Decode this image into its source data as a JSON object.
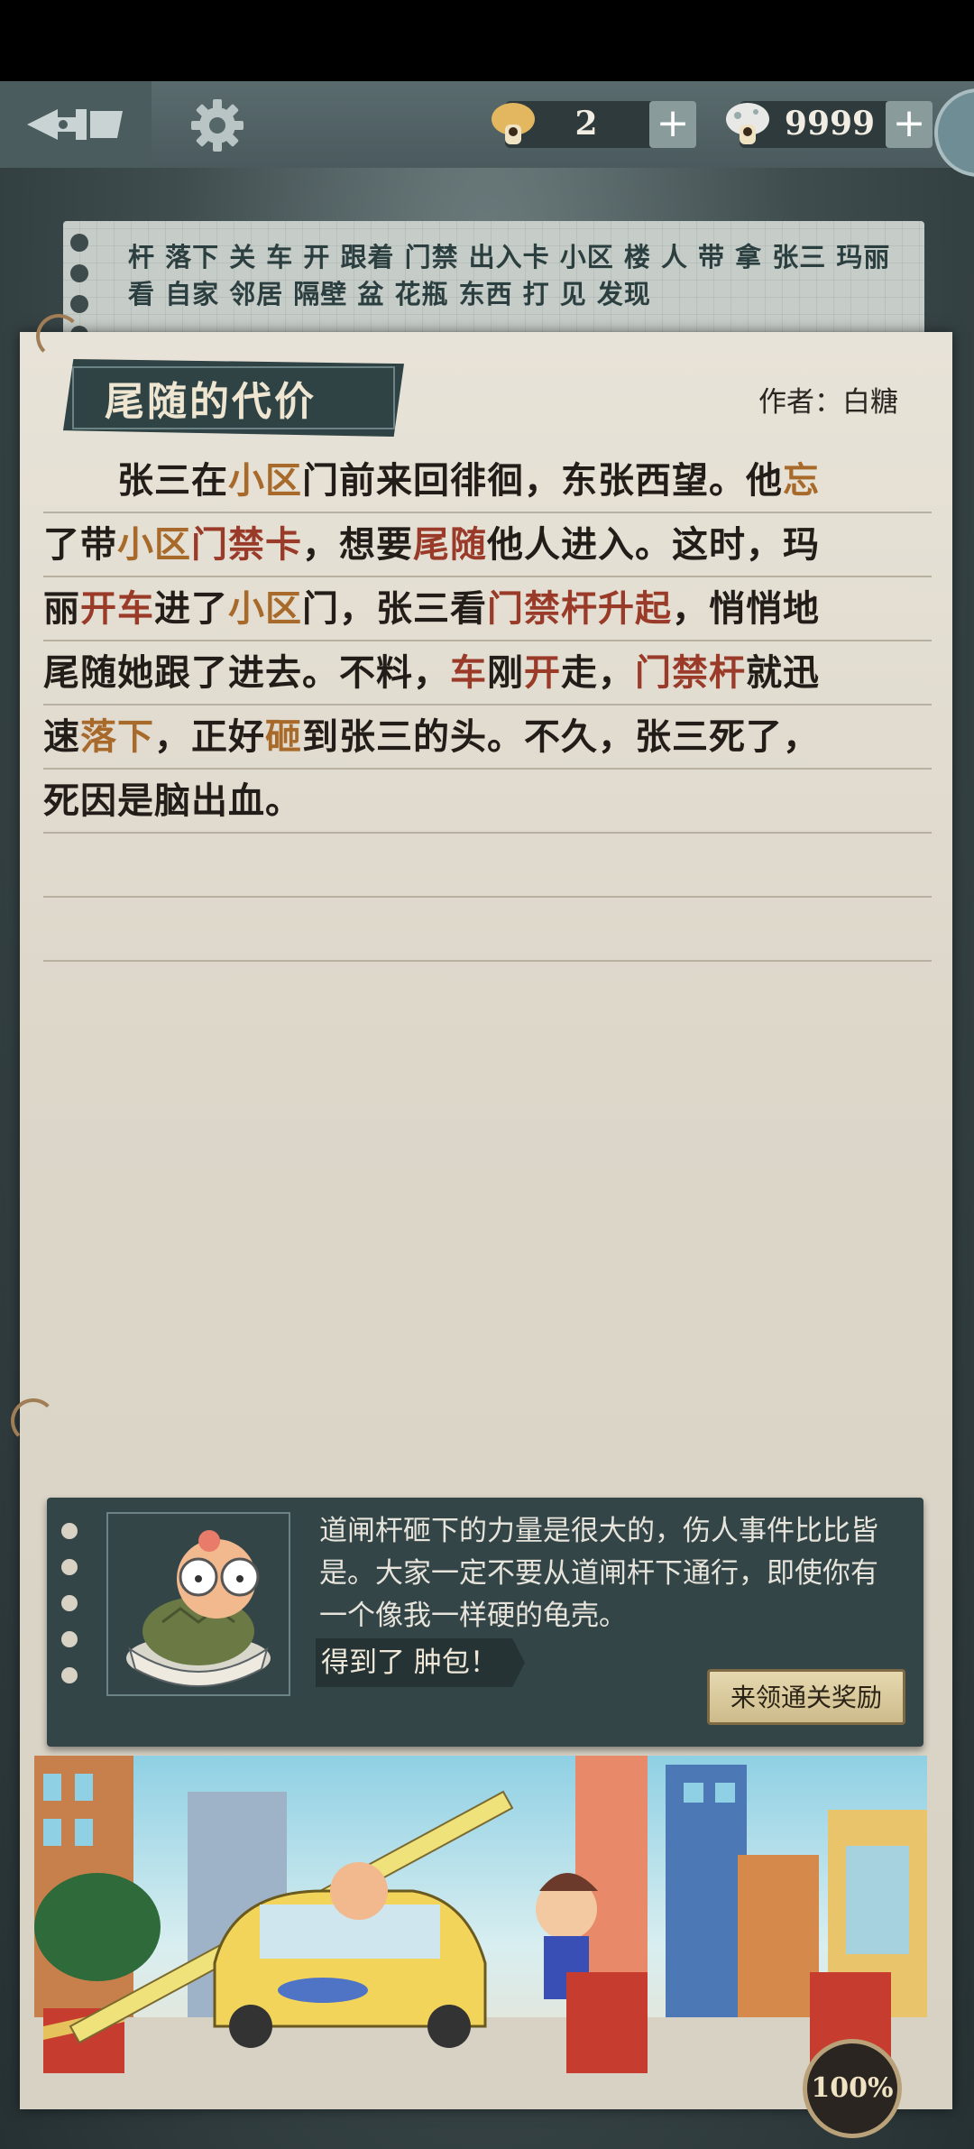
{
  "topbar": {
    "currency1": {
      "icon": "mushroom-icon",
      "value": "2"
    },
    "currency2": {
      "icon": "mushroom-spotted-icon",
      "value": "9999"
    }
  },
  "keywords": {
    "line1": "杆 落下 关 车 开 跟着 门禁 出入卡 小区 楼 人 带 拿 张三 玛丽",
    "line2": "看 自家 邻居 隔壁 盆 花瓶 东西 打 见 发现"
  },
  "story": {
    "title": "尾随的代价",
    "author": "作者：白糖",
    "lines": [
      [
        {
          "t": "　　张三在"
        },
        {
          "t": "小区",
          "c": "o"
        },
        {
          "t": "门前来回徘徊，东张西望。他"
        },
        {
          "t": "忘",
          "c": "o"
        }
      ],
      [
        {
          "t": "了带"
        },
        {
          "t": "小区",
          "c": "o"
        },
        {
          "t": "门禁卡",
          "c": "r"
        },
        {
          "t": "，想要"
        },
        {
          "t": "尾随",
          "c": "r"
        },
        {
          "t": "他人进入。这时，玛"
        }
      ],
      [
        {
          "t": "丽"
        },
        {
          "t": "开车",
          "c": "r"
        },
        {
          "t": "进了"
        },
        {
          "t": "小区",
          "c": "o"
        },
        {
          "t": "门，张三看"
        },
        {
          "t": "门禁杆升起",
          "c": "r"
        },
        {
          "t": "，悄悄地"
        }
      ],
      [
        {
          "t": "尾随她跟了进去。不料，"
        },
        {
          "t": "车",
          "c": "r"
        },
        {
          "t": "刚"
        },
        {
          "t": "开",
          "c": "r"
        },
        {
          "t": "走，"
        },
        {
          "t": "门禁杆",
          "c": "r"
        },
        {
          "t": "就迅"
        }
      ],
      [
        {
          "t": "速"
        },
        {
          "t": "落下",
          "c": "o"
        },
        {
          "t": "，正好"
        },
        {
          "t": "砸",
          "c": "o"
        },
        {
          "t": "到张三的头。不久，张三死了，"
        }
      ],
      [
        {
          "t": "死因是脑出血。"
        }
      ],
      [],
      []
    ]
  },
  "reward": {
    "message": "道闸杆砸下的力量是很大的，伤人事件比比皆是。大家一定不要从道闸杆下通行，即使你有一个像我一样硬的龟壳。",
    "got_label": "得到了 肿包！",
    "claim_label": "来领通关奖励"
  },
  "progress": "100%",
  "colors": {
    "highlight_orange": "#a86a2a",
    "highlight_red": "#9a3b2a"
  }
}
